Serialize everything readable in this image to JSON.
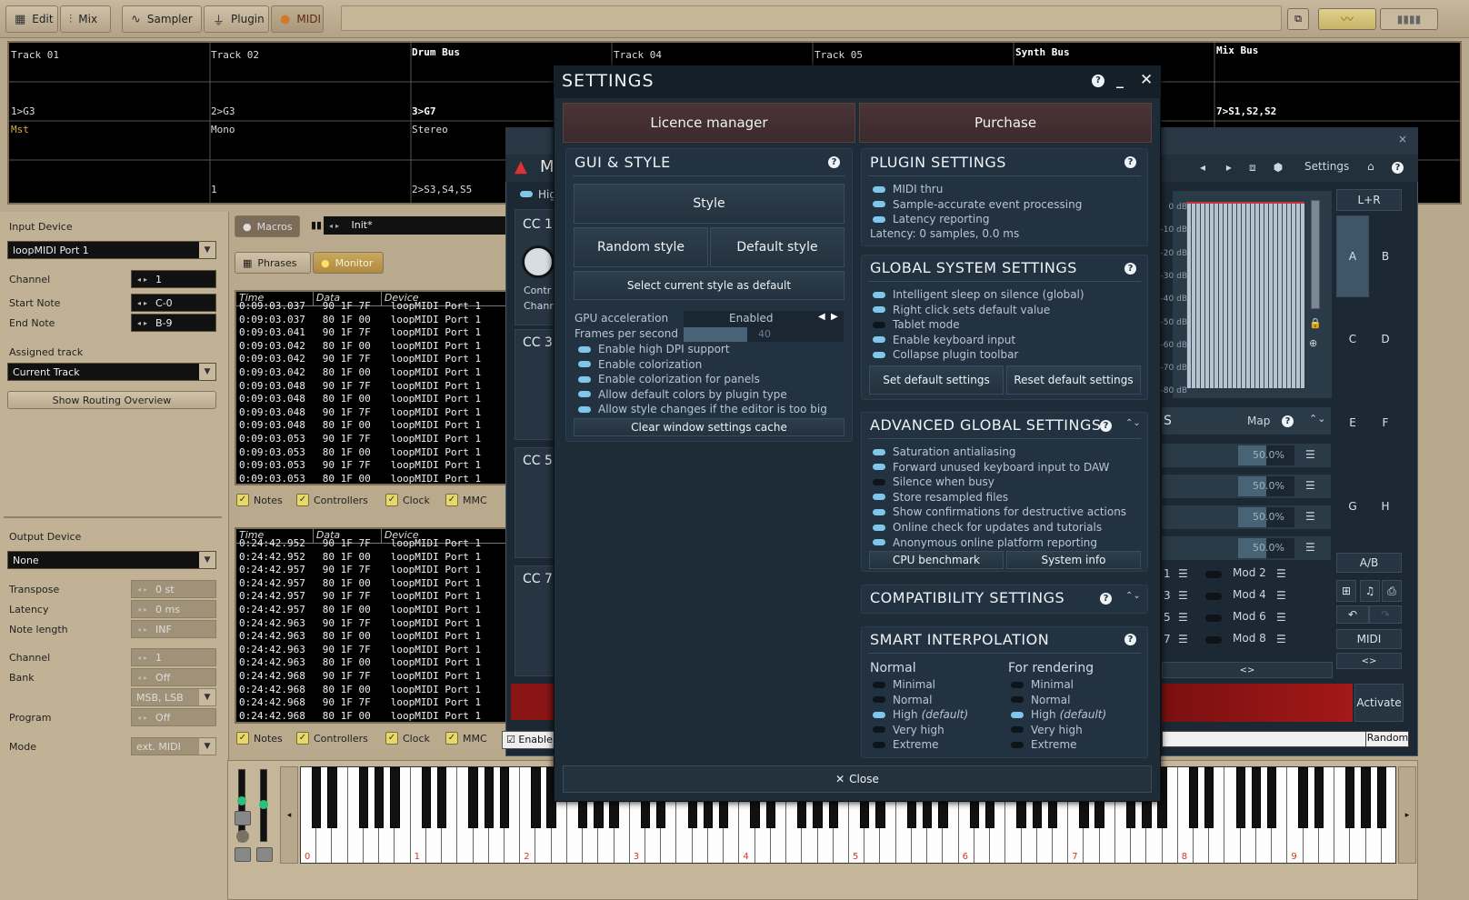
{
  "toolbar": {
    "edit": "Edit",
    "mix": "Mix",
    "sampler": "Sampler",
    "plugin": "Plugin",
    "midi": "MIDI"
  },
  "tracks": [
    {
      "name": "Track 01",
      "route": "1>G3",
      "mode": "Mst",
      "out": ""
    },
    {
      "name": "Track 02",
      "route": "2>G3",
      "mode": "Mono",
      "out": "1"
    },
    {
      "name": "Drum Bus",
      "route": "3>G7",
      "mode": "Stereo",
      "out": "2>S3,S4,S5"
    },
    {
      "name": "Track 04",
      "route": "",
      "mode": "",
      "out": ""
    },
    {
      "name": "Track 05",
      "route": "",
      "mode": "",
      "out": ""
    },
    {
      "name": "Synth Bus",
      "route": "",
      "mode": "",
      "out": ""
    },
    {
      "name": "Mix Bus",
      "route": "7>S1,S2,S2",
      "mode": "",
      "out": ""
    }
  ],
  "input": {
    "device_label": "Input Device",
    "device_value": "loopMIDI Port 1",
    "channel_label": "Channel",
    "channel_value": "1",
    "start_note_label": "Start Note",
    "start_note_value": "C-0",
    "end_note_label": "End Note",
    "end_note_value": "B-9",
    "assigned_label": "Assigned track",
    "assigned_value": "Current Track",
    "routing_button": "Show Routing Overview"
  },
  "output": {
    "device_label": "Output Device",
    "device_value": "None",
    "transpose_label": "Transpose",
    "transpose_value": "0 st",
    "latency_label": "Latency",
    "latency_value": "0 ms",
    "note_length_label": "Note length",
    "note_length_value": "INF",
    "channel_label": "Channel",
    "channel_value": "1",
    "bank_label": "Bank",
    "bank_value": "Off",
    "bank_mode": "MSB, LSB",
    "program_label": "Program",
    "program_value": "Off",
    "mode_label": "Mode",
    "mode_value": "ext. MIDI"
  },
  "middle": {
    "macros": "Macros",
    "preset": "Init*",
    "phrases": "Phrases",
    "monitor": "Monitor",
    "col_time": "Time",
    "col_data": "Data",
    "col_device": "Device",
    "filters": [
      "Notes",
      "Controllers",
      "Clock",
      "MMC"
    ]
  },
  "log1": [
    [
      "0:09:03.037",
      "90 1F 7F",
      "loopMIDI Port 1"
    ],
    [
      "0:09:03.037",
      "80 1F 00",
      "loopMIDI Port 1"
    ],
    [
      "0:09:03.041",
      "90 1F 7F",
      "loopMIDI Port 1"
    ],
    [
      "0:09:03.042",
      "80 1F 00",
      "loopMIDI Port 1"
    ],
    [
      "0:09:03.042",
      "90 1F 7F",
      "loopMIDI Port 1"
    ],
    [
      "0:09:03.042",
      "80 1F 00",
      "loopMIDI Port 1"
    ],
    [
      "0:09:03.048",
      "90 1F 7F",
      "loopMIDI Port 1"
    ],
    [
      "0:09:03.048",
      "80 1F 00",
      "loopMIDI Port 1"
    ],
    [
      "0:09:03.048",
      "90 1F 7F",
      "loopMIDI Port 1"
    ],
    [
      "0:09:03.048",
      "80 1F 00",
      "loopMIDI Port 1"
    ],
    [
      "0:09:03.053",
      "90 1F 7F",
      "loopMIDI Port 1"
    ],
    [
      "0:09:03.053",
      "80 1F 00",
      "loopMIDI Port 1"
    ],
    [
      "0:09:03.053",
      "90 1F 7F",
      "loopMIDI Port 1"
    ],
    [
      "0:09:03.053",
      "80 1F 00",
      "loopMIDI Port 1"
    ]
  ],
  "log2": [
    [
      "0:24:42.952",
      "90 1F 7F",
      "loopMIDI Port 1"
    ],
    [
      "0:24:42.952",
      "80 1F 00",
      "loopMIDI Port 1"
    ],
    [
      "0:24:42.957",
      "90 1F 7F",
      "loopMIDI Port 1"
    ],
    [
      "0:24:42.957",
      "80 1F 00",
      "loopMIDI Port 1"
    ],
    [
      "0:24:42.957",
      "90 1F 7F",
      "loopMIDI Port 1"
    ],
    [
      "0:24:42.957",
      "80 1F 00",
      "loopMIDI Port 1"
    ],
    [
      "0:24:42.963",
      "90 1F 7F",
      "loopMIDI Port 1"
    ],
    [
      "0:24:42.963",
      "80 1F 00",
      "loopMIDI Port 1"
    ],
    [
      "0:24:42.963",
      "90 1F 7F",
      "loopMIDI Port 1"
    ],
    [
      "0:24:42.963",
      "80 1F 00",
      "loopMIDI Port 1"
    ],
    [
      "0:24:42.968",
      "90 1F 7F",
      "loopMIDI Port 1"
    ],
    [
      "0:24:42.968",
      "80 1F 00",
      "loopMIDI Port 1"
    ],
    [
      "0:24:42.968",
      "90 1F 7F",
      "loopMIDI Port 1"
    ],
    [
      "0:24:42.968",
      "80 1F 00",
      "loopMIDI Port 1"
    ]
  ],
  "plugin": {
    "logo_letter": "M",
    "hig_label": "Hig",
    "cc_labels": [
      "CC 1",
      "CC 3",
      "CC 5",
      "CC 7"
    ],
    "ctrl_label": "Contr",
    "chan_label": "Chann",
    "settings_label": "Settings",
    "enable_label": "Enable",
    "lr": "L+R",
    "slots": [
      "A",
      "B",
      "C",
      "D",
      "E",
      "F",
      "G",
      "H"
    ],
    "db_ticks": [
      "0 dB",
      "-10 dB",
      "-20 dB",
      "-30 dB",
      "-40 dB",
      "-50 dB",
      "-60 dB",
      "-70 dB",
      "-80 dB"
    ],
    "map_label": "Map",
    "s_label": "S",
    "percents": [
      "50.0%",
      "50.0%",
      "50.0%",
      "50.0%"
    ],
    "mods": [
      "Mod 2",
      "Mod 4",
      "Mod 6",
      "Mod 8"
    ],
    "mod_nums": [
      "1",
      "3",
      "5",
      "7"
    ],
    "ab": "A/B",
    "midi": "MIDI",
    "activate": "Activate",
    "random": "Random",
    "arrows": "<>"
  },
  "piano": {
    "octaves": [
      "0",
      "1",
      "2",
      "3",
      "4",
      "5",
      "6",
      "7",
      "8",
      "9"
    ]
  },
  "settings": {
    "title": "SETTINGS",
    "licence": "Licence manager",
    "purchase": "Purchase",
    "gui": {
      "title": "GUI & STYLE",
      "style": "Style",
      "random": "Random style",
      "default": "Default style",
      "select_default": "Select current style as default",
      "gpu_label": "GPU acceleration",
      "gpu_value": "Enabled",
      "fps_label": "Frames per second",
      "fps_value": "40",
      "options": [
        "Enable high DPI support",
        "Enable colorization",
        "Enable colorization for panels",
        "Allow default colors by plugin type",
        "Allow style changes if the editor is too big"
      ],
      "clear_cache": "Clear window settings cache"
    },
    "plugin": {
      "title": "PLUGIN SETTINGS",
      "options": [
        "MIDI thru",
        "Sample-accurate event processing",
        "Latency reporting"
      ],
      "latency_info": "Latency: 0 samples, 0.0 ms"
    },
    "global": {
      "title": "GLOBAL SYSTEM SETTINGS",
      "options": [
        {
          "label": "Intelligent sleep on silence (global)",
          "on": true
        },
        {
          "label": "Right click sets default value",
          "on": true
        },
        {
          "label": "Tablet mode",
          "on": false
        },
        {
          "label": "Enable keyboard input",
          "on": true
        },
        {
          "label": "Collapse plugin toolbar",
          "on": true
        }
      ],
      "set_default": "Set default settings",
      "reset_default": "Reset default settings"
    },
    "advanced": {
      "title": "ADVANCED GLOBAL SETTINGS",
      "options": [
        {
          "label": "Saturation antialiasing",
          "on": true
        },
        {
          "label": "Forward unused keyboard input to DAW",
          "on": true
        },
        {
          "label": "Silence when busy",
          "on": false
        },
        {
          "label": "Store resampled files",
          "on": true
        },
        {
          "label": "Show confirmations for destructive actions",
          "on": true
        },
        {
          "label": "Online check for updates and tutorials",
          "on": true
        },
        {
          "label": "Anonymous online platform reporting",
          "on": true
        }
      ],
      "cpu_benchmark": "CPU benchmark",
      "system_info": "System info"
    },
    "compat": {
      "title": "COMPATIBILITY SETTINGS"
    },
    "smart": {
      "title": "SMART INTERPOLATION",
      "normal_title": "Normal",
      "render_title": "For rendering",
      "normal": [
        {
          "label": "Minimal",
          "on": false
        },
        {
          "label": "Normal",
          "on": false
        },
        {
          "label": "High",
          "suffix": "(default)",
          "on": true
        },
        {
          "label": "Very high",
          "on": false
        },
        {
          "label": "Extreme",
          "on": false
        }
      ],
      "render": [
        {
          "label": "Minimal",
          "on": false
        },
        {
          "label": "Normal",
          "on": false
        },
        {
          "label": "High",
          "suffix": "(default)",
          "on": true
        },
        {
          "label": "Very high",
          "on": false
        },
        {
          "label": "Extreme",
          "on": false
        }
      ]
    },
    "close": "Close"
  },
  "colors": {
    "accent_led": "#7fc6ea",
    "dialog_bg": "#1e2c38",
    "host_bg": "#b8a88c",
    "octave_label": "#d23a1a"
  }
}
